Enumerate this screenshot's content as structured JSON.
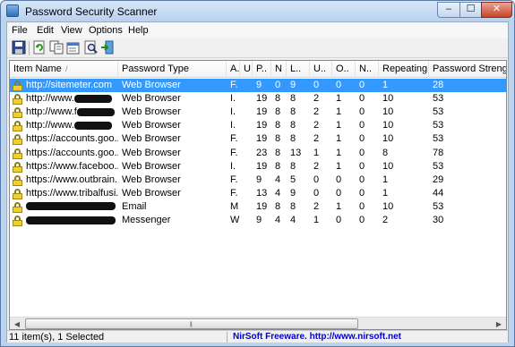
{
  "window": {
    "title": "Password Security Scanner",
    "minimize_label": "–",
    "maximize_label": "☐",
    "close_label": "✕"
  },
  "menu": [
    "File",
    "Edit",
    "View",
    "Options",
    "Help"
  ],
  "toolbar": {
    "buttons": [
      "save-icon",
      "refresh-icon",
      "copy-icon",
      "properties-icon",
      "find-icon",
      "exit-icon"
    ]
  },
  "columns": [
    "Item Name",
    "Password Type",
    "A.",
    "U",
    "P..",
    "N",
    "L..",
    "U..",
    "O..",
    "N..",
    "Repeating",
    "Password Strength"
  ],
  "sort_indicator": "/",
  "rows": [
    {
      "name": "http://sitemeter.com",
      "type": "Web Browser",
      "a": "F.",
      "u": "",
      "p": "9",
      "n": "0",
      "l": "9",
      "u2": "0",
      "o": "0",
      "n2": "0",
      "repeating": "1",
      "strength": "28",
      "redacted": 0,
      "selected": true
    },
    {
      "name": "http://www.",
      "type": "Web Browser",
      "a": "I.",
      "u": "",
      "p": "19",
      "n": "8",
      "l": "8",
      "u2": "2",
      "o": "1",
      "n2": "0",
      "repeating": "10",
      "strength": "53",
      "redacted": 1,
      "selected": false
    },
    {
      "name": "http://www.f",
      "type": "Web Browser",
      "a": "I.",
      "u": "",
      "p": "19",
      "n": "8",
      "l": "8",
      "u2": "2",
      "o": "1",
      "n2": "0",
      "repeating": "10",
      "strength": "53",
      "redacted": 1,
      "selected": false
    },
    {
      "name": "http://www.",
      "type": "Web Browser",
      "a": "I.",
      "u": "",
      "p": "19",
      "n": "8",
      "l": "8",
      "u2": "2",
      "o": "1",
      "n2": "0",
      "repeating": "10",
      "strength": "53",
      "redacted": 1,
      "selected": false
    },
    {
      "name": "https://accounts.goo...",
      "type": "Web Browser",
      "a": "F.",
      "u": "",
      "p": "19",
      "n": "8",
      "l": "8",
      "u2": "2",
      "o": "1",
      "n2": "0",
      "repeating": "10",
      "strength": "53",
      "redacted": 0,
      "selected": false
    },
    {
      "name": "https://accounts.goo...",
      "type": "Web Browser",
      "a": "F.",
      "u": "",
      "p": "23",
      "n": "8",
      "l": "13",
      "u2": "1",
      "o": "1",
      "n2": "0",
      "repeating": "8",
      "strength": "78",
      "redacted": 0,
      "selected": false
    },
    {
      "name": "https://www.faceboo...",
      "type": "Web Browser",
      "a": "I.",
      "u": "",
      "p": "19",
      "n": "8",
      "l": "8",
      "u2": "2",
      "o": "1",
      "n2": "0",
      "repeating": "10",
      "strength": "53",
      "redacted": 0,
      "selected": false
    },
    {
      "name": "https://www.outbrain...",
      "type": "Web Browser",
      "a": "F.",
      "u": "",
      "p": "9",
      "n": "4",
      "l": "5",
      "u2": "0",
      "o": "0",
      "n2": "0",
      "repeating": "1",
      "strength": "29",
      "redacted": 0,
      "selected": false
    },
    {
      "name": "https://www.tribalfusi...",
      "type": "Web Browser",
      "a": "F.",
      "u": "",
      "p": "13",
      "n": "4",
      "l": "9",
      "u2": "0",
      "o": "0",
      "n2": "0",
      "repeating": "1",
      "strength": "44",
      "redacted": 0,
      "selected": false
    },
    {
      "name": "",
      "type": "Email",
      "a": "M",
      "u": "",
      "p": "19",
      "n": "8",
      "l": "8",
      "u2": "2",
      "o": "1",
      "n2": "0",
      "repeating": "10",
      "strength": "53",
      "redacted": 2,
      "selected": false
    },
    {
      "name": "",
      "type": "Messenger",
      "a": "W",
      "u": "",
      "p": "9",
      "n": "4",
      "l": "4",
      "u2": "1",
      "o": "0",
      "n2": "0",
      "repeating": "2",
      "strength": "30",
      "redacted": 2,
      "selected": false
    }
  ],
  "status": {
    "count": "11 item(s), 1 Selected",
    "credit": "NirSoft Freeware.  http://www.nirsoft.net"
  }
}
